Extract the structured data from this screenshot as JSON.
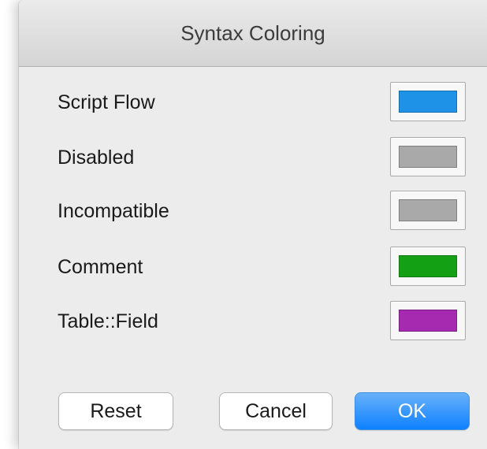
{
  "dialog": {
    "title": "Syntax Coloring"
  },
  "rows": [
    {
      "label": "Script Flow",
      "color": "#1e92e6"
    },
    {
      "label": "Disabled",
      "color": "#a9a9a9"
    },
    {
      "label": "Incompatible",
      "color": "#a9a9a9"
    },
    {
      "label": "Comment",
      "color": "#14a014"
    },
    {
      "label": "Table::Field",
      "color": "#a62ab0"
    }
  ],
  "buttons": {
    "reset": "Reset",
    "cancel": "Cancel",
    "ok": "OK"
  }
}
